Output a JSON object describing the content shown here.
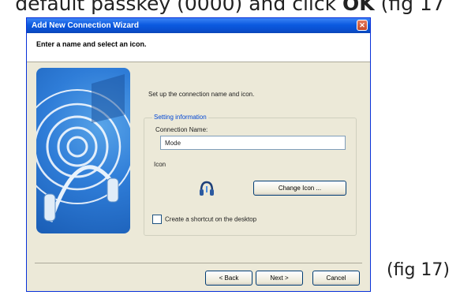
{
  "document": {
    "instruction_start": "default passkey (",
    "instruction_code": "0000",
    "instruction_mid": ") and click ",
    "instruction_bold": "OK",
    "instruction_end": " (fig 17",
    "figure_label": "(fig 17)"
  },
  "window": {
    "title": "Add New Connection Wizard",
    "header_text": "Enter a name and select an icon.",
    "intro_text": "Set up the connection name and icon.",
    "group_title": "Setting information",
    "connection_name_label": "Connection Name:",
    "connection_name_value": "Mode",
    "icon_label": "Icon",
    "change_icon_button": "Change Icon ...",
    "shortcut_label": "Create a shortcut on the desktop",
    "back_button": "< Back",
    "next_button": "Next >",
    "cancel_button": "Cancel"
  },
  "colors": {
    "titlebar": "#0b5ae0",
    "dialog_bg": "#ece9d8",
    "art_blue": "#2f7dd8",
    "group_title": "#0046d5"
  },
  "icons": {
    "close": "close-icon",
    "headset": "headset-icon",
    "art": "headset-art"
  }
}
